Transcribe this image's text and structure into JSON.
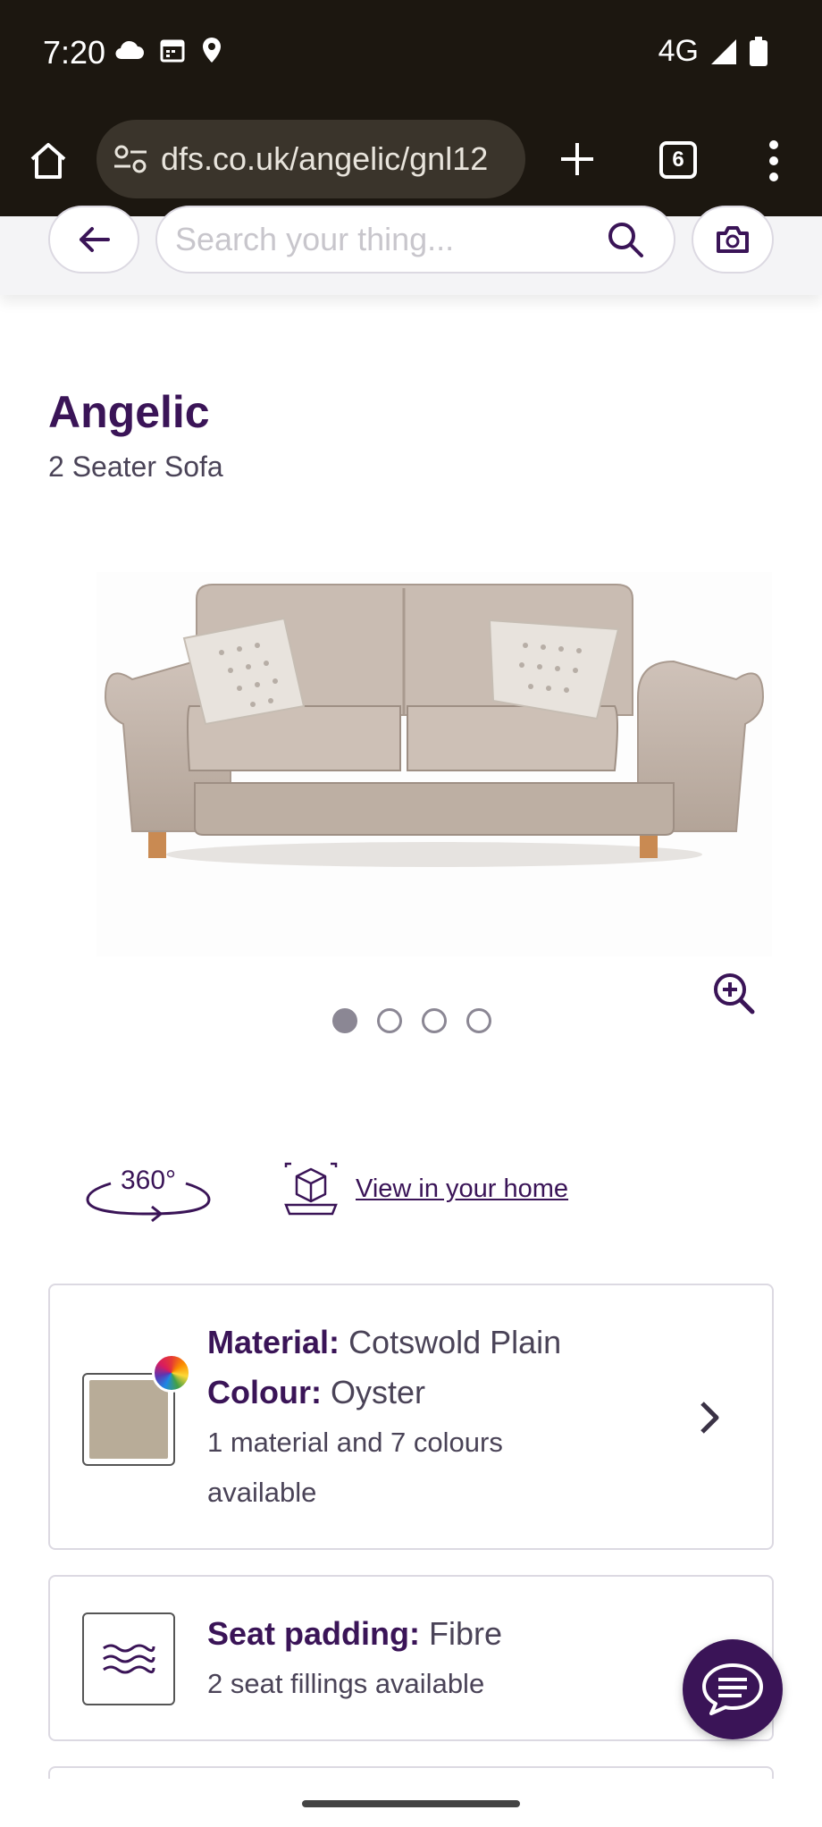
{
  "status_bar": {
    "time": "7:20",
    "network": "4G",
    "left_icons": [
      "cloud-icon",
      "calendar-icon",
      "location-icon"
    ],
    "right_icons": [
      "signal-icon",
      "battery-icon"
    ]
  },
  "browser": {
    "url": "dfs.co.uk/angelic/gnl12",
    "tab_count": "6",
    "icons": [
      "home-icon",
      "tune-icon",
      "plus-icon",
      "tabs-icon",
      "more-vert-icon"
    ]
  },
  "header": {
    "search_placeholder": "Search your thing...",
    "icons": [
      "back-arrow-icon",
      "search-icon",
      "camera-icon"
    ]
  },
  "product": {
    "title": "Angelic",
    "subtitle": "2 Seater Sofa",
    "image_alt": "sofa",
    "carousel": {
      "total": 4,
      "active": 1
    }
  },
  "view_options": {
    "view_360_label": "360°",
    "ar_link": "View in your home"
  },
  "material_card": {
    "material_label": "Material:",
    "material_value": "Cotswold Plain",
    "colour_label": "Colour:",
    "colour_value": "Oyster",
    "availability_line1": "1 material and 7 colours",
    "availability_line2": "available",
    "swatch_color": "#b8ac98"
  },
  "padding_card": {
    "label": "Seat padding:",
    "value": "Fibre",
    "availability": "2 seat fillings available"
  },
  "colors": {
    "brand": "#3a1457",
    "chrome": "#1c1710"
  }
}
